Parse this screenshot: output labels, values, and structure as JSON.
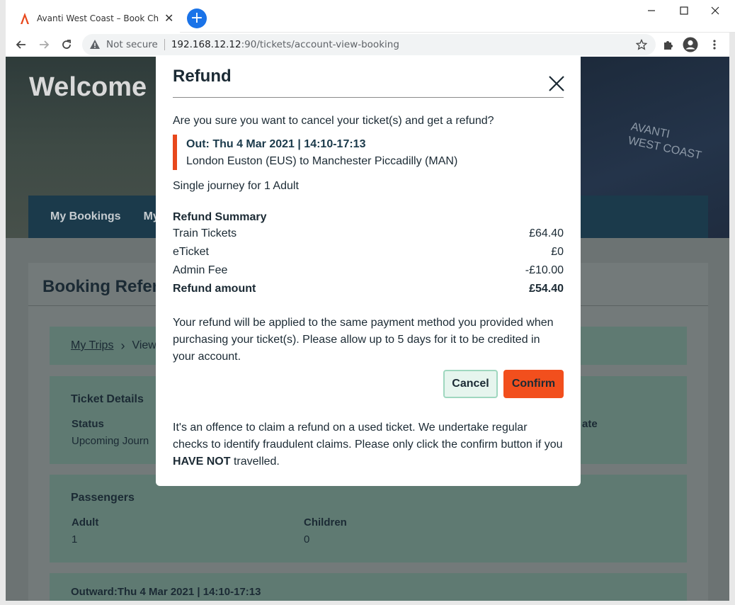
{
  "browser": {
    "tab_title": "Avanti West Coast – Book Cheap Train Tickets",
    "security_label": "Not secure",
    "url_host": "192.168.12.12",
    "url_path": ":90/tickets/account-view-booking",
    "new_tab_symbol": "+",
    "close_tab_symbol": "✕"
  },
  "page": {
    "welcome": "Welcome",
    "brand_line1": "AVANTI",
    "brand_line2": "WEST COAST",
    "nav": [
      "My Bookings",
      "My"
    ],
    "booking_heading": "Booking Refere",
    "breadcrumb": {
      "link": "My Trips",
      "current": "View"
    },
    "ticket_details": {
      "heading": "Ticket Details",
      "status_label": "Status",
      "status_value": "Upcoming Journ",
      "right_label": "ate"
    },
    "passengers": {
      "heading": "Passengers",
      "adult_label": "Adult",
      "adult_value": "1",
      "children_label": "Children",
      "children_value": "0"
    },
    "outward": "Outward:Thu 4 Mar 2021 | 14:10-17:13"
  },
  "modal": {
    "title": "Refund",
    "question": "Are you sure you want to cancel your ticket(s) and get a refund?",
    "out_line": "Out: Thu 4 Mar 2021 | 14:10-17:13",
    "route": "London Euston (EUS) to Manchester Piccadilly (MAN)",
    "journey_type": "Single journey for 1 Adult",
    "summary_heading": "Refund Summary",
    "summary": [
      {
        "label": "Train Tickets",
        "value": "£64.40"
      },
      {
        "label": "eTicket",
        "value": "£0"
      },
      {
        "label": "Admin Fee",
        "value": "-£10.00"
      },
      {
        "label": "Refund amount",
        "value": "£54.40"
      }
    ],
    "note": "Your refund will be applied to the same payment method you provided when purchasing your ticket(s). Please allow up to 5 days for it to be credited in your account.",
    "cancel_label": "Cancel",
    "confirm_label": "Confirm",
    "warning_pre": "It's an offence to claim a refund on a used ticket. We undertake regular checks to identify fraudulent claims. Please only click the confirm button if you",
    "warning_bold": "HAVE NOT",
    "warning_post": "travelled."
  },
  "colors": {
    "accent": "#f24f1d",
    "cancel_bg": "#e6f5ee",
    "navy": "#1b3a4b"
  }
}
